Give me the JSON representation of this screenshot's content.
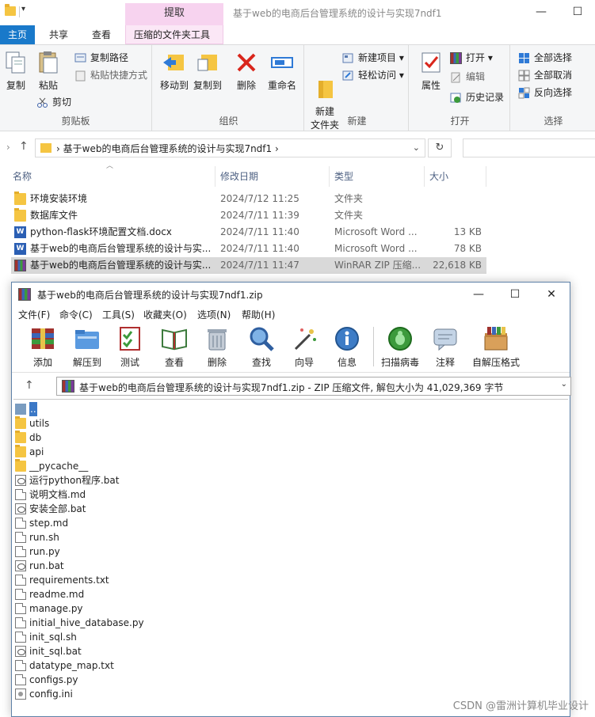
{
  "explorer": {
    "window_title": "基于web的电商后台管理系统的设计与实现7ndf1",
    "context_tab_label": "提取",
    "window_buttons": [
      "—",
      "☐",
      "✕"
    ],
    "tabs": [
      "主页",
      "共享",
      "查看",
      "压缩的文件夹工具"
    ],
    "ribbon": {
      "clipboard": {
        "label": "剪贴板",
        "copy": "复制",
        "paste": "粘贴",
        "copy_path": "复制路径",
        "paste_shortcut": "粘贴快捷方式",
        "cut": "剪切"
      },
      "organize": {
        "label": "组织",
        "move_to": "移动到",
        "copy_to": "复制到",
        "delete": "删除",
        "rename": "重命名"
      },
      "new": {
        "label": "新建",
        "new_folder": "新建\n文件夹",
        "new_item": "新建项目",
        "easy_access": "轻松访问"
      },
      "open": {
        "label": "打开",
        "properties": "属性",
        "open": "打开",
        "edit": "编辑",
        "history": "历史记录"
      },
      "select": {
        "label": "选择",
        "select_all": "全部选择",
        "select_none": "全部取消",
        "invert": "反向选择"
      }
    },
    "address": "基于web的电商后台管理系统的设计与实现7ndf1",
    "columns": {
      "name": "名称",
      "date": "修改日期",
      "type": "类型",
      "size": "大小"
    },
    "files": [
      {
        "icon": "folder",
        "name": "环境安装环境",
        "date": "2024/7/12 11:25",
        "type": "文件夹",
        "size": ""
      },
      {
        "icon": "folder",
        "name": "数据库文件",
        "date": "2024/7/11 11:39",
        "type": "文件夹",
        "size": ""
      },
      {
        "icon": "word",
        "name": "python-flask环境配置文档.docx",
        "date": "2024/7/11 11:40",
        "type": "Microsoft Word ...",
        "size": "13 KB"
      },
      {
        "icon": "word",
        "name": "基于web的电商后台管理系统的设计与实...",
        "date": "2024/7/11 11:40",
        "type": "Microsoft Word ...",
        "size": "78 KB"
      },
      {
        "icon": "rar",
        "name": "基于web的电商后台管理系统的设计与实...",
        "date": "2024/7/11 11:47",
        "type": "WinRAR ZIP 压缩...",
        "size": "22,618 KB"
      }
    ]
  },
  "winrar": {
    "title": "基于web的电商后台管理系统的设计与实现7ndf1.zip",
    "window_buttons": [
      "—",
      "☐",
      "✕"
    ],
    "menu": [
      "文件(F)",
      "命令(C)",
      "工具(S)",
      "收藏夹(O)",
      "选项(N)",
      "帮助(H)"
    ],
    "toolbar": [
      "添加",
      "解压到",
      "测试",
      "查看",
      "删除",
      "查找",
      "向导",
      "信息",
      "扫描病毒",
      "注释",
      "自解压格式"
    ],
    "path": "基于web的电商后台管理系统的设计与实现7ndf1.zip - ZIP 压缩文件, 解包大小为 41,029,369 字节",
    "items": [
      {
        "icon": "up",
        "name": ".."
      },
      {
        "icon": "folder",
        "name": "utils"
      },
      {
        "icon": "folder",
        "name": "db"
      },
      {
        "icon": "folder",
        "name": "api"
      },
      {
        "icon": "folder",
        "name": "__pycache__"
      },
      {
        "icon": "bat",
        "name": "运行python程序.bat"
      },
      {
        "icon": "file",
        "name": "说明文档.md"
      },
      {
        "icon": "bat",
        "name": "安装全部.bat"
      },
      {
        "icon": "file",
        "name": "step.md"
      },
      {
        "icon": "file",
        "name": "run.sh"
      },
      {
        "icon": "file",
        "name": "run.py"
      },
      {
        "icon": "bat",
        "name": "run.bat"
      },
      {
        "icon": "file",
        "name": "requirements.txt"
      },
      {
        "icon": "file",
        "name": "readme.md"
      },
      {
        "icon": "file",
        "name": "manage.py"
      },
      {
        "icon": "file",
        "name": "initial_hive_database.py"
      },
      {
        "icon": "file",
        "name": "init_sql.sh"
      },
      {
        "icon": "bat",
        "name": "init_sql.bat"
      },
      {
        "icon": "file",
        "name": "datatype_map.txt"
      },
      {
        "icon": "file",
        "name": "configs.py"
      },
      {
        "icon": "ini",
        "name": "config.ini"
      }
    ]
  },
  "watermark": "CSDN @雷洲计算机毕业设计"
}
